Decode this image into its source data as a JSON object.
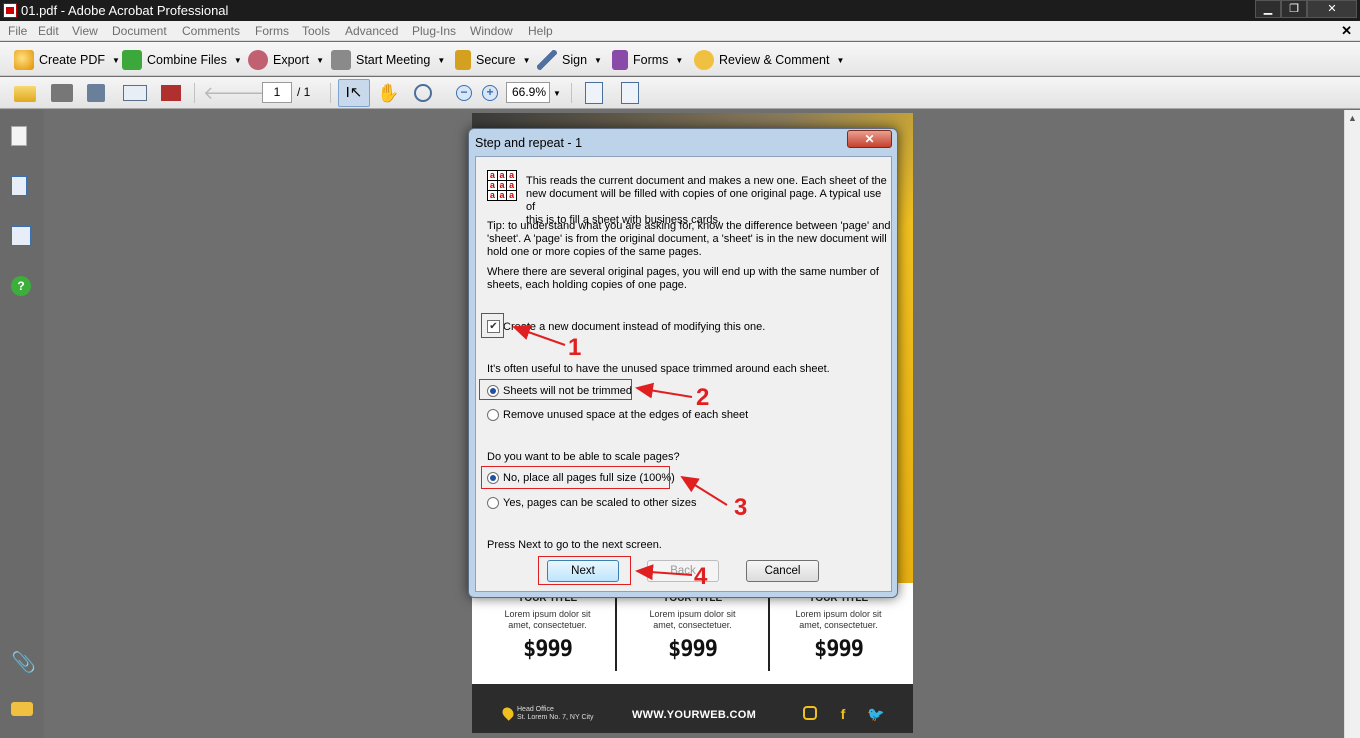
{
  "window": {
    "title": "01.pdf - Adobe Acrobat Professional",
    "min": "▁",
    "restore": "❐",
    "close": "✕"
  },
  "menu": [
    "File",
    "Edit",
    "View",
    "Document",
    "Comments",
    "Forms",
    "Tools",
    "Advanced",
    "Plug-Ins",
    "Window",
    "Help"
  ],
  "doc_close": "✕",
  "toolbar": {
    "create_pdf": "Create PDF",
    "combine_files": "Combine Files",
    "export": "Export",
    "start_meeting": "Start Meeting",
    "secure": "Secure",
    "sign": "Sign",
    "forms": "Forms",
    "review_comment": "Review & Comment"
  },
  "nav": {
    "page_current": "1",
    "page_total": "/ 1",
    "zoom": "66.9%"
  },
  "page_content": {
    "cols": [
      {
        "title": "YOUR TITLE",
        "desc1": "Lorem ipsum dolor sit",
        "desc2": "amet, consectetuer.",
        "price": "$999"
      },
      {
        "title": "YOUR TITLE",
        "desc1": "Lorem ipsum dolor sit",
        "desc2": "amet, consectetuer.",
        "price": "$999"
      },
      {
        "title": "YOUR TITLE",
        "desc1": "Lorem ipsum dolor sit",
        "desc2": "amet, consectetuer.",
        "price": "$999"
      }
    ],
    "office_line1": "Head Office",
    "office_line2": "St. Lorem No. 7, NY City",
    "website": "WWW.YOURWEB.COM",
    "social": [
      "instagram-icon",
      "facebook-icon",
      "twitter-icon"
    ]
  },
  "dialog": {
    "title": "Step and repeat - 1",
    "close": "✕",
    "grid_letter": "a",
    "intro1": "This reads the current document and makes a new one. Each sheet of the",
    "intro2": "new document will be filled with copies of one original page. A typical use of",
    "intro3": "this is to fill a sheet with business cards.",
    "tip1": "Tip: to understand what you are asking for, know the difference between 'page' and",
    "tip2": "'sheet'.  A 'page' is from the original document, a 'sheet' is in the new document will",
    "tip3": "hold one or more copies of the same pages.",
    "where1": "Where there are several original pages, you will end up with the same number of",
    "where2": "sheets, each holding copies of one page.",
    "create_new_label": "Create a new document instead of modifying this one.",
    "create_new_checked": true,
    "trim_question": "It's often useful to have the unused space trimmed around each sheet.",
    "trim_option1": "Sheets will not be trimmed",
    "trim_option2": "Remove unused space at the edges of each sheet",
    "scale_question": "Do you want to be able to scale pages?",
    "scale_option1": "No, place all pages full size (100%)",
    "scale_option2": "Yes, pages can be scaled to other sizes",
    "press_next": "Press Next to go to the next screen.",
    "next_button": "Next",
    "back_button": "Back",
    "cancel_button": "Cancel"
  },
  "annotations": [
    "1",
    "2",
    "3",
    "4"
  ],
  "colors": {
    "annotation_red": "#e02020",
    "accent_yellow": "#f0c020"
  }
}
